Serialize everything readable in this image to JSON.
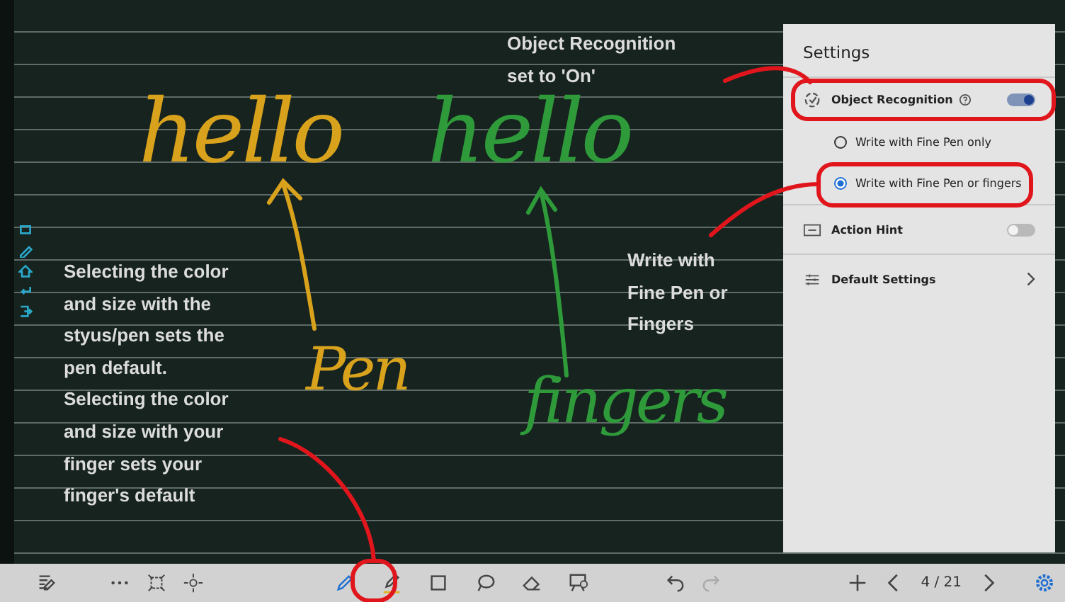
{
  "board": {
    "handwriting": [
      {
        "text": "hello",
        "color": "#d9a21c"
      },
      {
        "text": "hello",
        "color": "#2f9a3a"
      },
      {
        "text": "Pen",
        "color": "#d9a21c"
      },
      {
        "text": "fingers",
        "color": "#2f9a3a"
      }
    ],
    "callouts": [
      "Object Recognition set to 'On'",
      "Write with Fine Pen or Fingers",
      "Selecting the color and size with the styus/pen sets the pen default. Selecting the color and size with your finger sets your finger's default"
    ]
  },
  "settings": {
    "title": "Settings",
    "object_recognition": {
      "label": "Object Recognition",
      "on": true
    },
    "modes": [
      {
        "label": "Write with Fine Pen only",
        "selected": false
      },
      {
        "label": "Write with Fine Pen or fingers",
        "selected": true
      }
    ],
    "action_hint": {
      "label": "Action Hint",
      "on": false
    },
    "default_settings": {
      "label": "Default Settings"
    }
  },
  "toolbar": {
    "tools": [
      {
        "kind": "pen",
        "selected": true
      },
      {
        "kind": "highlighter",
        "selected": false
      },
      {
        "kind": "shape",
        "selected": false
      },
      {
        "kind": "lasso",
        "selected": false
      },
      {
        "kind": "eraser",
        "selected": false
      },
      {
        "kind": "board",
        "selected": false
      }
    ],
    "page": "4 / 21"
  }
}
